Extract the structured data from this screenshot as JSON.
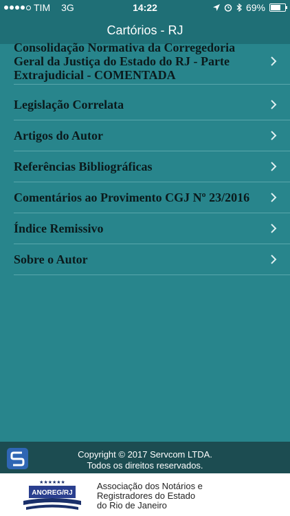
{
  "status": {
    "carrier": "TIM",
    "network": "3G",
    "time": "14:22",
    "battery": "69%",
    "battery_level": 0.69
  },
  "header": {
    "title": "Cartórios - RJ"
  },
  "menu": [
    {
      "label": "Consolidação Normativa da Corregedoria Geral da Justiça do Estado do RJ - Parte Extrajudicial - COMENTADA"
    },
    {
      "label": "Legislação Correlata"
    },
    {
      "label": "Artigos do Autor"
    },
    {
      "label": "Referências Bibliográficas"
    },
    {
      "label": "Comentários ao Provimento CGJ Nº 23/2016"
    },
    {
      "label": "Índice Remissivo"
    },
    {
      "label": "Sobre o Autor"
    }
  ],
  "footer": {
    "copyright_line1": "Copyright © 2017 Servcom LTDA.",
    "copyright_line2": "Todos os direitos reservados."
  },
  "association": {
    "logo_text": "ANOREG/RJ",
    "line1": "Associação dos Notários e",
    "line2": "Registradores do Estado",
    "line3": "do Rio de Janeiro"
  },
  "colors": {
    "background": "#28858c",
    "header": "#1f6f76",
    "footer": "#1c4c51"
  }
}
